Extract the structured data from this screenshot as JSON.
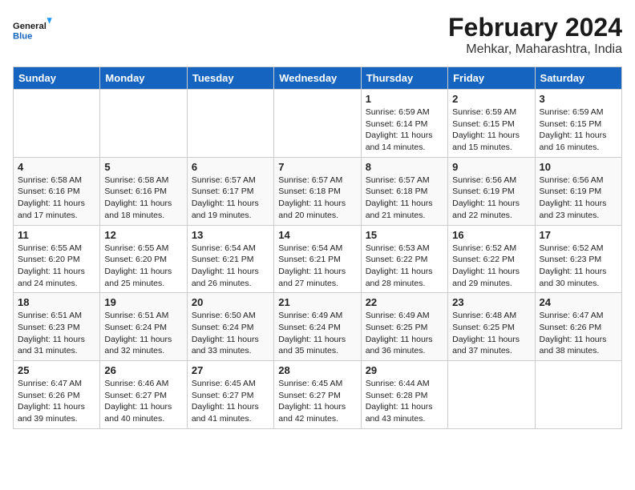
{
  "header": {
    "logo_line1": "General",
    "logo_line2": "Blue",
    "title": "February 2024",
    "subtitle": "Mehkar, Maharashtra, India"
  },
  "days_of_week": [
    "Sunday",
    "Monday",
    "Tuesday",
    "Wednesday",
    "Thursday",
    "Friday",
    "Saturday"
  ],
  "weeks": [
    [
      {
        "day": "",
        "info": ""
      },
      {
        "day": "",
        "info": ""
      },
      {
        "day": "",
        "info": ""
      },
      {
        "day": "",
        "info": ""
      },
      {
        "day": "1",
        "info": "Sunrise: 6:59 AM\nSunset: 6:14 PM\nDaylight: 11 hours and 14 minutes."
      },
      {
        "day": "2",
        "info": "Sunrise: 6:59 AM\nSunset: 6:15 PM\nDaylight: 11 hours and 15 minutes."
      },
      {
        "day": "3",
        "info": "Sunrise: 6:59 AM\nSunset: 6:15 PM\nDaylight: 11 hours and 16 minutes."
      }
    ],
    [
      {
        "day": "4",
        "info": "Sunrise: 6:58 AM\nSunset: 6:16 PM\nDaylight: 11 hours and 17 minutes."
      },
      {
        "day": "5",
        "info": "Sunrise: 6:58 AM\nSunset: 6:16 PM\nDaylight: 11 hours and 18 minutes."
      },
      {
        "day": "6",
        "info": "Sunrise: 6:57 AM\nSunset: 6:17 PM\nDaylight: 11 hours and 19 minutes."
      },
      {
        "day": "7",
        "info": "Sunrise: 6:57 AM\nSunset: 6:18 PM\nDaylight: 11 hours and 20 minutes."
      },
      {
        "day": "8",
        "info": "Sunrise: 6:57 AM\nSunset: 6:18 PM\nDaylight: 11 hours and 21 minutes."
      },
      {
        "day": "9",
        "info": "Sunrise: 6:56 AM\nSunset: 6:19 PM\nDaylight: 11 hours and 22 minutes."
      },
      {
        "day": "10",
        "info": "Sunrise: 6:56 AM\nSunset: 6:19 PM\nDaylight: 11 hours and 23 minutes."
      }
    ],
    [
      {
        "day": "11",
        "info": "Sunrise: 6:55 AM\nSunset: 6:20 PM\nDaylight: 11 hours and 24 minutes."
      },
      {
        "day": "12",
        "info": "Sunrise: 6:55 AM\nSunset: 6:20 PM\nDaylight: 11 hours and 25 minutes."
      },
      {
        "day": "13",
        "info": "Sunrise: 6:54 AM\nSunset: 6:21 PM\nDaylight: 11 hours and 26 minutes."
      },
      {
        "day": "14",
        "info": "Sunrise: 6:54 AM\nSunset: 6:21 PM\nDaylight: 11 hours and 27 minutes."
      },
      {
        "day": "15",
        "info": "Sunrise: 6:53 AM\nSunset: 6:22 PM\nDaylight: 11 hours and 28 minutes."
      },
      {
        "day": "16",
        "info": "Sunrise: 6:52 AM\nSunset: 6:22 PM\nDaylight: 11 hours and 29 minutes."
      },
      {
        "day": "17",
        "info": "Sunrise: 6:52 AM\nSunset: 6:23 PM\nDaylight: 11 hours and 30 minutes."
      }
    ],
    [
      {
        "day": "18",
        "info": "Sunrise: 6:51 AM\nSunset: 6:23 PM\nDaylight: 11 hours and 31 minutes."
      },
      {
        "day": "19",
        "info": "Sunrise: 6:51 AM\nSunset: 6:24 PM\nDaylight: 11 hours and 32 minutes."
      },
      {
        "day": "20",
        "info": "Sunrise: 6:50 AM\nSunset: 6:24 PM\nDaylight: 11 hours and 33 minutes."
      },
      {
        "day": "21",
        "info": "Sunrise: 6:49 AM\nSunset: 6:24 PM\nDaylight: 11 hours and 35 minutes."
      },
      {
        "day": "22",
        "info": "Sunrise: 6:49 AM\nSunset: 6:25 PM\nDaylight: 11 hours and 36 minutes."
      },
      {
        "day": "23",
        "info": "Sunrise: 6:48 AM\nSunset: 6:25 PM\nDaylight: 11 hours and 37 minutes."
      },
      {
        "day": "24",
        "info": "Sunrise: 6:47 AM\nSunset: 6:26 PM\nDaylight: 11 hours and 38 minutes."
      }
    ],
    [
      {
        "day": "25",
        "info": "Sunrise: 6:47 AM\nSunset: 6:26 PM\nDaylight: 11 hours and 39 minutes."
      },
      {
        "day": "26",
        "info": "Sunrise: 6:46 AM\nSunset: 6:27 PM\nDaylight: 11 hours and 40 minutes."
      },
      {
        "day": "27",
        "info": "Sunrise: 6:45 AM\nSunset: 6:27 PM\nDaylight: 11 hours and 41 minutes."
      },
      {
        "day": "28",
        "info": "Sunrise: 6:45 AM\nSunset: 6:27 PM\nDaylight: 11 hours and 42 minutes."
      },
      {
        "day": "29",
        "info": "Sunrise: 6:44 AM\nSunset: 6:28 PM\nDaylight: 11 hours and 43 minutes."
      },
      {
        "day": "",
        "info": ""
      },
      {
        "day": "",
        "info": ""
      }
    ]
  ]
}
